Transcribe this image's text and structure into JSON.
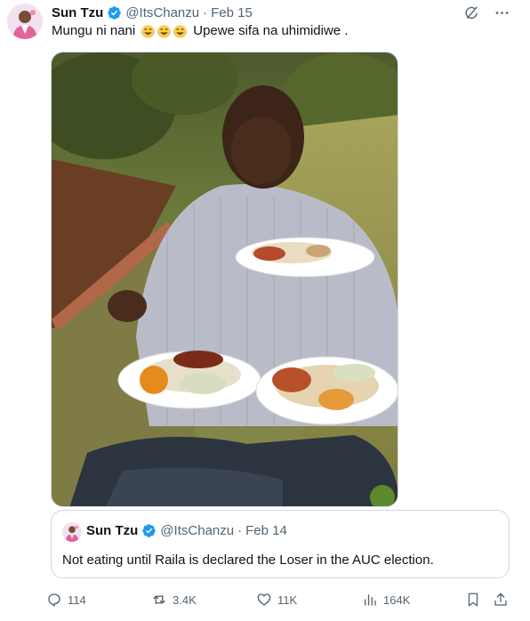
{
  "tweet": {
    "author_name": "Sun Tzu",
    "handle": "@ItsChanzu",
    "separator": "·",
    "date": "Feb 15",
    "text_before": "Mungu ni nani",
    "emojis": [
      "face-with-tears-of-joy",
      "face-with-tears-of-joy",
      "face-with-tears-of-joy"
    ],
    "text_after": "Upewe sifa na uhimidiwe ."
  },
  "header_icons": [
    "grok-icon",
    "more-icon"
  ],
  "quote": {
    "author_name": "Sun Tzu",
    "handle": "@ItsChanzu",
    "separator": "·",
    "date": "Feb 14",
    "text": "Not eating until Raila is declared the Loser in the AUC election."
  },
  "actions": {
    "replies": "114",
    "reposts": "3.4K",
    "likes": "11K",
    "views": "164K"
  },
  "colors": {
    "verified": "#1d9bf0",
    "muted": "#536471",
    "border": "#cfd9de"
  }
}
